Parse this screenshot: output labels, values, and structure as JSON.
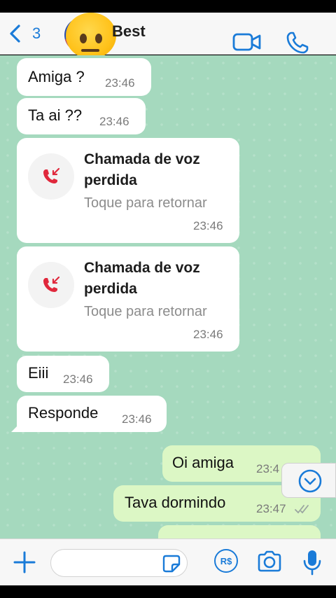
{
  "header": {
    "back_count": "3",
    "contact_name": "Best",
    "icons": {
      "back": "chevron-left-icon",
      "video": "video-camera-icon",
      "call": "phone-icon"
    }
  },
  "messages": [
    {
      "direction": "in",
      "text": "Amiga ?",
      "time": "23:46"
    },
    {
      "direction": "in",
      "text": "Ta ai ??",
      "time": "23:46"
    },
    {
      "direction": "in",
      "type": "missed-call",
      "title_line1": "Chamada de voz",
      "title_line2": "perdida",
      "subtitle": "Toque para retornar",
      "time": "23:46"
    },
    {
      "direction": "in",
      "type": "missed-call",
      "title_line1": "Chamada de voz",
      "title_line2": "perdida",
      "subtitle": "Toque para retornar",
      "time": "23:46"
    },
    {
      "direction": "in",
      "text": "Eiii",
      "time": "23:46"
    },
    {
      "direction": "in",
      "text": "Responde",
      "time": "23:46"
    },
    {
      "direction": "out",
      "text": "Oi amiga",
      "time": "23:4"
    },
    {
      "direction": "out",
      "text": "Tava dormindo",
      "time": "23:47"
    }
  ],
  "input": {
    "icons": {
      "add": "plus-icon",
      "sticker": "sticker-icon",
      "payment": "pix-real-icon",
      "camera": "camera-icon",
      "mic": "microphone-icon"
    },
    "payment_label": "R$"
  },
  "colors": {
    "chat_bg": "#a5d9be",
    "outgoing_bubble": "#dcf7c5",
    "incoming_bubble": "#ffffff",
    "accent_blue": "#1a7bd8",
    "missed_call_red": "#e0283c"
  }
}
